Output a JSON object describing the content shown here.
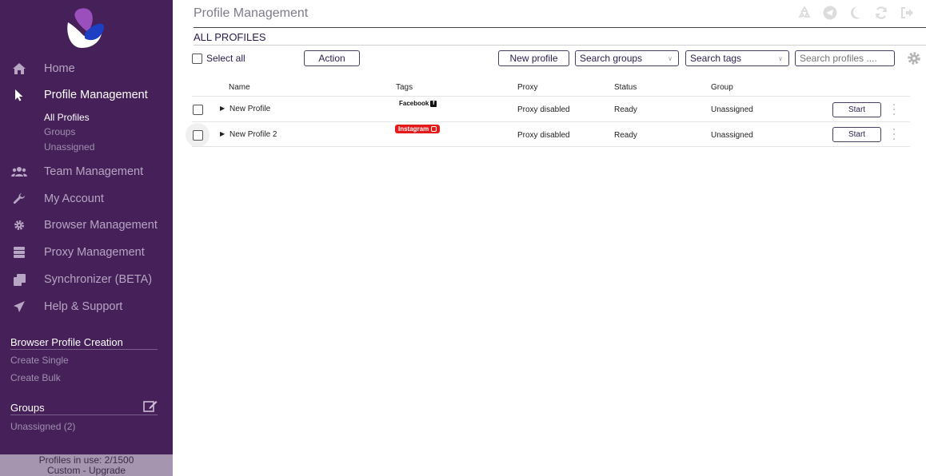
{
  "colors": {
    "sidebar_bg": "#452059",
    "accent": "#2a1b4a",
    "instagram": "#e41a1a"
  },
  "sidebar": {
    "nav": [
      {
        "label": "Home",
        "icon": "home-icon"
      },
      {
        "label": "Profile Management",
        "icon": "cursor-icon",
        "active": true
      },
      {
        "label": "Team Management",
        "icon": "users-icon"
      },
      {
        "label": "My Account",
        "icon": "wrench-icon"
      },
      {
        "label": "Browser Management",
        "icon": "gear-icon"
      },
      {
        "label": "Proxy Management",
        "icon": "server-icon"
      },
      {
        "label": "Synchronizer (BETA)",
        "icon": "copy-icon"
      },
      {
        "label": "Help & Support",
        "icon": "paper-plane-icon"
      }
    ],
    "profile_sub": [
      "All Profiles",
      "Groups",
      "Unassigned"
    ],
    "creation_title": "Browser Profile Creation",
    "creation_links": [
      "Create Single",
      "Create Bulk"
    ],
    "groups_title": "Groups",
    "groups_links": [
      "Unassigned (2)"
    ],
    "footer": {
      "line1": "Profiles in use:  2/1500",
      "line2": "Custom - Upgrade"
    }
  },
  "header": {
    "title": "Profile Management",
    "icons": [
      "recycle-icon",
      "telegram-icon",
      "moon-icon",
      "refresh-icon",
      "logout-icon"
    ],
    "subtitle": "ALL PROFILES"
  },
  "toolbar": {
    "select_all": "Select all",
    "action": "Action",
    "new_profile": "New profile",
    "search_groups": "Search groups",
    "search_tags": "Search tags",
    "search_profiles_placeholder": "Search profiles ....",
    "settings_icon": "gear-icon"
  },
  "table": {
    "columns": [
      "Name",
      "Tags",
      "Proxy",
      "Status",
      "Group"
    ],
    "rows": [
      {
        "name": "New Profile",
        "tag": "Facebook",
        "tag_icon": "facebook-icon",
        "proxy": "Proxy disabled",
        "status": "Ready",
        "group": "Unassigned",
        "action": "Start"
      },
      {
        "name": "New Profile 2",
        "tag": "Instagram",
        "tag_icon": "instagram-icon",
        "proxy": "Proxy disabled",
        "status": "Ready",
        "group": "Unassigned",
        "action": "Start"
      }
    ]
  }
}
